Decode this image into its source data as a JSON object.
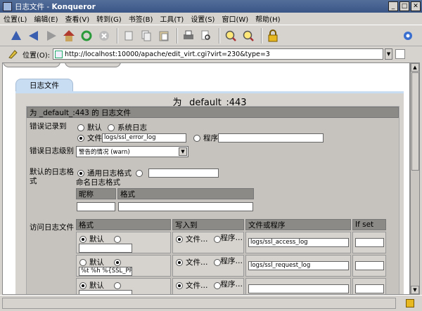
{
  "window": {
    "title_prefix": "日志文件 - ",
    "title_app": "Konqueror"
  },
  "menu": [
    "位置(L)",
    "编辑(E)",
    "查看(V)",
    "转到(G)",
    "书签(B)",
    "工具(T)",
    "设置(S)",
    "窗口(W)",
    "帮助(H)"
  ],
  "location": {
    "label": "位置(O):",
    "url": "http://localhost:10000/apache/edit_virt.cgi?virt=230&type=3"
  },
  "page": {
    "tab_label": "日志文件",
    "title": "为 _default_:443",
    "section_header": "为 _default_:443 的 日志文件",
    "error_log": {
      "label": "错误记录到",
      "opt_default": "默认",
      "opt_syslog": "系统日志",
      "opt_file": "文件",
      "file_value": "logs/ssl_error_log",
      "opt_program": "程序",
      "program_value": ""
    },
    "error_level": {
      "label": "错误日志级别",
      "value": "警告的情况 (warn)"
    },
    "default_format": {
      "label": "默认的日志格式",
      "opt_common": "通用日志格式",
      "custom_value": "",
      "named_label": "命名日志格式",
      "col_name": "昵称",
      "col_format": "格式",
      "name_value": "",
      "format_value": ""
    },
    "access_log": {
      "label": "访问日志文件",
      "col_format": "格式",
      "col_write_to": "写入到",
      "col_file": "文件或程序",
      "col_ifset": "If set",
      "opt_default": "默认",
      "opt_file": "文件…",
      "opt_program": "程序…",
      "rows": [
        {
          "format_value": "",
          "file": "logs/ssl_access_log"
        },
        {
          "format_value": "%t %h %{SSL_PROT",
          "file": "logs/ssl_request_log"
        },
        {
          "format_value": "",
          "file": ""
        }
      ]
    }
  }
}
